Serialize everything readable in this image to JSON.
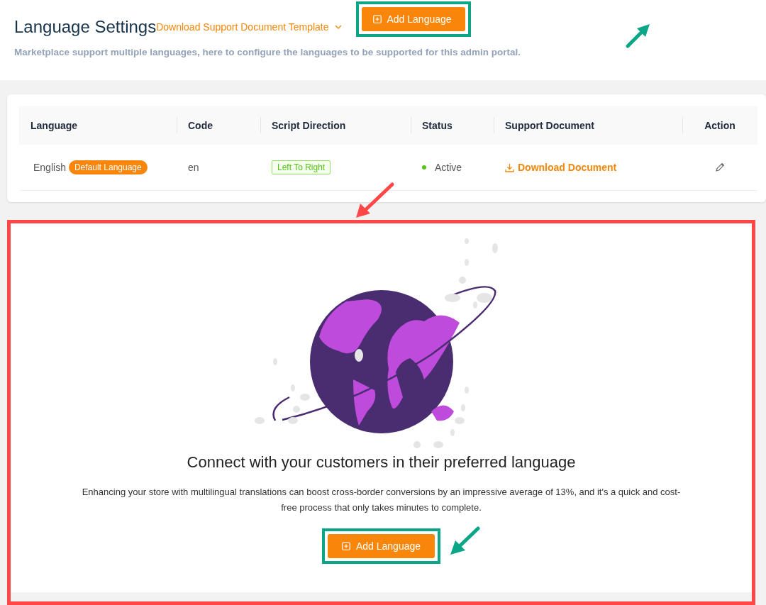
{
  "header": {
    "title": "Language Settings",
    "subtitle": "Marketplace support multiple languages, here to configure the languages to be supported for this admin portal.",
    "template_link": "Download Support Document Template",
    "add_button": "Add Language"
  },
  "table": {
    "columns": [
      "Language",
      "Code",
      "Script Direction",
      "Status",
      "Support Document",
      "Action"
    ],
    "rows": [
      {
        "language": "English",
        "badge": "Default Language",
        "code": "en",
        "direction": "Left To Right",
        "status": {
          "label": "Active",
          "color": "#52c41a"
        },
        "document": "Download Document"
      }
    ]
  },
  "empty_state": {
    "heading": "Connect with your customers in their preferred language",
    "text": "Enhancing your store with multilingual translations can boost cross-border conversions by an impressive average of 13%, and it's a quick and cost-free process that only takes minutes to complete.",
    "button": "Add Language"
  }
}
